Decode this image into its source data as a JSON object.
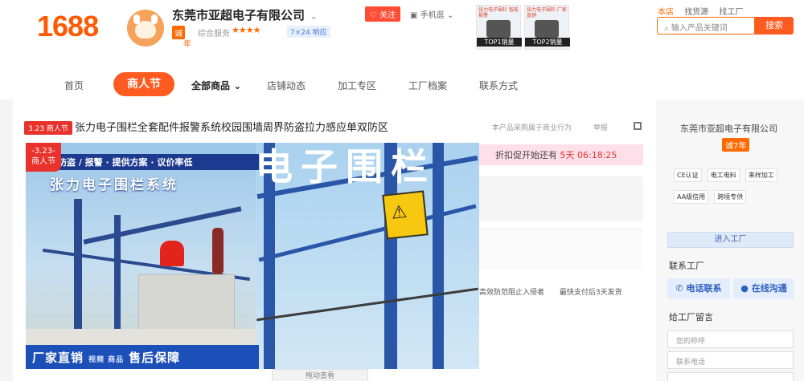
{
  "brand": {
    "logo": "1688"
  },
  "company": {
    "name": "东莞市亚超电子有限公司",
    "years_badge": "诚",
    "years_label": "年",
    "service_label": "综合服务",
    "stars": "★★★★",
    "response": "7×24 响应"
  },
  "header": {
    "follow_label": "关注",
    "mobile_label": "手机逛",
    "ads": [
      {
        "caption": "张力电子围栏 智能报警",
        "label": "TOP1销量"
      },
      {
        "caption": "张力电子围栏 厂家直销",
        "label": "TOP2销量"
      }
    ],
    "links": [
      "本店",
      "找货源",
      "找工厂"
    ],
    "search_placeholder": "输入产品关键词",
    "search_button": "搜索"
  },
  "nav": {
    "home": "首页",
    "festival": "商人节",
    "all_products": "全部商品",
    "store_news": "店铺动态",
    "custom": "加工专区",
    "factory": "工厂档案",
    "contact": "联系方式"
  },
  "product": {
    "tag": "3.23 商人节",
    "title": "张力电子围栏全套配件报警系统校园围墙周界防盗拉力感应单双防区",
    "report": "本产品采购属于商业行为",
    "share": "举报"
  },
  "banner": {
    "badge_date": "-3.23-",
    "badge_text": "商人节",
    "promo_line": "防盗 / 报警 · 提供方案 · 议价率低",
    "promo_title": "张力电子围栏系统",
    "bottom_left": "厂家直销",
    "bottom_mid": "视频 商品",
    "bottom_right": "售后保障",
    "big_text": "电子围栏",
    "sign_symbol": "⚠"
  },
  "countdown": {
    "text": "折扣促开始还有",
    "time": "5天 06:18:25"
  },
  "features": [
    "高效防范阻止入侵者",
    "最快支付后3天发货"
  ],
  "pager": {
    "label": "拖动查看"
  },
  "side": {
    "company": "东莞市亚超电子有限公司",
    "years": "诚7年",
    "certs": [
      "CE认证",
      "电工电料",
      "来样加工",
      "AA级信用",
      "跨境专供"
    ],
    "enter_factory": "进入工厂",
    "contact_heading": "联系工厂",
    "phone_button": "电话联系",
    "chat_button": "在线沟通",
    "form_heading": "给工厂留言",
    "name_placeholder": "您的称呼",
    "phone_placeholder": "联系电话"
  },
  "colors": {
    "brand": "#ff5a00",
    "accent": "#ff5a1f",
    "promo_red": "#e8322b",
    "blue": "#1d4fb8"
  }
}
